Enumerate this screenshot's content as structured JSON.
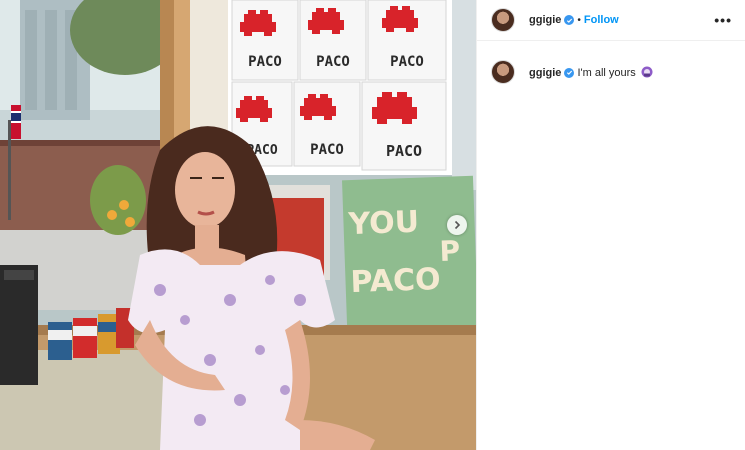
{
  "post": {
    "username": "ggigie",
    "follow_label": "Follow",
    "separator": "•",
    "more_label": "•••",
    "caption": "I'm all yours",
    "caption_emoji": "purple-heart-emoji"
  },
  "photo": {
    "mosaic_label": "PACO",
    "poster_lines": [
      "YOU",
      "PACO",
      "P"
    ],
    "next_icon": "chevron-right-icon"
  },
  "colors": {
    "accent": "#0095f6",
    "verified": "#3897f0",
    "invader_red": "#d8232a",
    "poster_green": "#8fbc8f"
  }
}
